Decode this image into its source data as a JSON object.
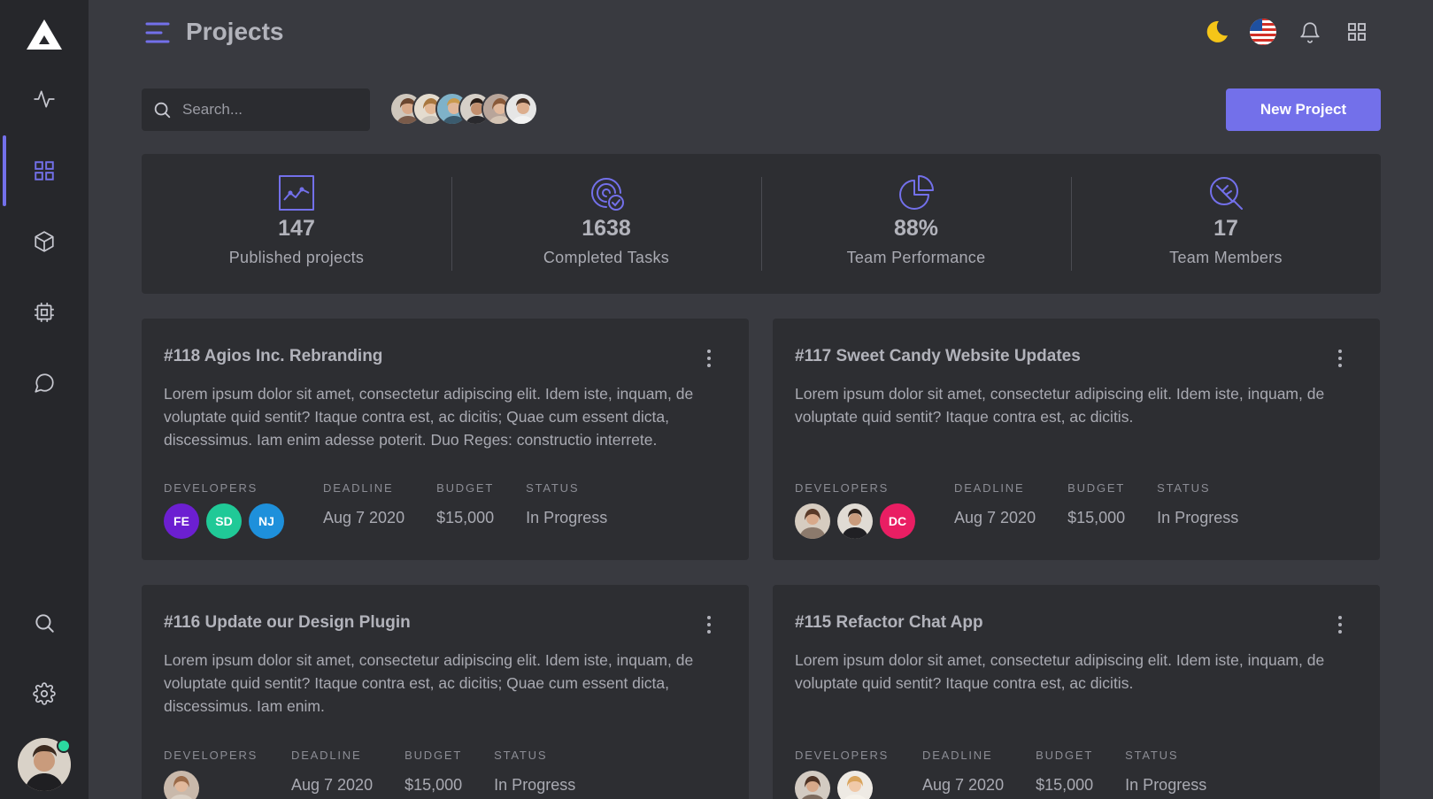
{
  "header": {
    "title": "Projects"
  },
  "search": {
    "placeholder": "Search..."
  },
  "actions": {
    "new_project": "New Project"
  },
  "theme": {
    "accent": "#7370ea",
    "sidebar_bg": "#26272b",
    "page_bg": "#393a40",
    "card_bg": "#2d2e32"
  },
  "top_icons": [
    "moon-icon",
    "us-flag-icon",
    "bell-icon",
    "apps-grid-icon"
  ],
  "sidebar": {
    "items": [
      {
        "name": "activity",
        "icon": "activity-icon"
      },
      {
        "name": "dashboard",
        "icon": "grid-icon",
        "active": true
      },
      {
        "name": "products",
        "icon": "box-icon"
      },
      {
        "name": "hardware",
        "icon": "cpu-icon"
      },
      {
        "name": "chat",
        "icon": "message-icon"
      },
      {
        "name": "search",
        "icon": "search-icon"
      },
      {
        "name": "settings",
        "icon": "settings-icon"
      }
    ]
  },
  "stats": [
    {
      "value": "147",
      "label": "Published projects",
      "icon": "chart-icon"
    },
    {
      "value": "1638",
      "label": "Completed Tasks",
      "icon": "target-check-icon"
    },
    {
      "value": "88%",
      "label": "Team Performance",
      "icon": "pie-chart-icon"
    },
    {
      "value": "17",
      "label": "Team Members",
      "icon": "leaf-search-icon"
    }
  ],
  "meta_labels": {
    "developers": "DEVELOPERS",
    "deadline": "DEADLINE",
    "budget": "BUDGET",
    "status": "STATUS"
  },
  "projects": [
    {
      "title": "#118 Agios Inc. Rebranding",
      "description": "Lorem ipsum dolor sit amet, consectetur adipiscing elit. Idem iste, inquam, de voluptate quid sentit? Itaque contra est, ac dicitis; Quae cum essent dicta, discessimus. Iam enim adesse poterit. Duo Reges: constructio interrete.",
      "deadline": "Aug 7 2020",
      "budget": "$15,000",
      "status": "In Progress",
      "developers": [
        {
          "initials": "FE",
          "color": "#6c1fd1"
        },
        {
          "initials": "SD",
          "color": "#20c997"
        },
        {
          "initials": "NJ",
          "color": "#1e90db"
        }
      ]
    },
    {
      "title": "#117 Sweet Candy Website Updates",
      "description": "Lorem ipsum dolor sit amet, consectetur adipiscing elit. Idem iste, inquam, de voluptate quid sentit? Itaque contra est, ac dicitis.",
      "deadline": "Aug 7 2020",
      "budget": "$15,000",
      "status": "In Progress",
      "developers": [
        {
          "initials": "DC",
          "color": "#e91e63"
        }
      ]
    },
    {
      "title": "#116 Update our Design Plugin",
      "description": "Lorem ipsum dolor sit amet, consectetur adipiscing elit. Idem iste, inquam, de voluptate quid sentit? Itaque contra est, ac dicitis; Quae cum essent dicta, discessimus. Iam enim.",
      "deadline": "Aug 7 2020",
      "budget": "$15,000",
      "status": "In Progress"
    },
    {
      "title": "#115 Refactor Chat App",
      "description": "Lorem ipsum dolor sit amet, consectetur adipiscing elit. Idem iste, inquam, de voluptate quid sentit? Itaque contra est, ac dicitis.",
      "deadline": "Aug 7 2020",
      "budget": "$15,000",
      "status": "In Progress"
    }
  ]
}
